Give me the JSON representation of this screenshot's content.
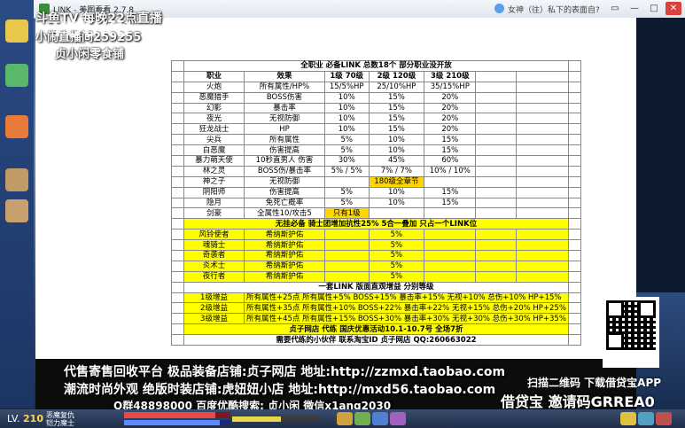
{
  "window": {
    "title": "LINK - 美图看看 2.7.8",
    "notice": "女神（往）私下的表面自?",
    "buttons": [
      "▭",
      "—",
      "□",
      "✕"
    ]
  },
  "stream_overlay": {
    "line1": "斗鱼TV 每晚22点直播",
    "line2": "小闹直播间259255",
    "line3": "贞小闲零食铺",
    "watermark": "YOUKU"
  },
  "sheet": {
    "title": "全职业  必备LINK 总数18个  部分职业没开放",
    "headers": [
      "职业",
      "效果",
      "1级 70级",
      "2级 120级",
      "3级 210级"
    ],
    "rows": [
      [
        "火炮",
        "所有属性/HP%",
        "15/5%HP",
        "25/10%HP",
        "35/15%HP"
      ],
      [
        "恶魔猎手",
        "BOSS伤害",
        "10%",
        "15%",
        "20%"
      ],
      [
        "幻影",
        "暴击率",
        "10%",
        "15%",
        "20%"
      ],
      [
        "夜光",
        "无视防御",
        "10%",
        "15%",
        "20%"
      ],
      [
        "狂龙战士",
        "HP",
        "10%",
        "15%",
        "20%"
      ],
      [
        "尖兵",
        "所有属性",
        "5%",
        "10%",
        "15%"
      ],
      [
        "白恶魔",
        "伤害提高",
        "5%",
        "10%",
        "15%"
      ],
      [
        "暴力萌天使",
        "10秒直男人 伤害",
        "30%",
        "45%",
        "60%"
      ],
      [
        "林之灵",
        "BOSS伤/暴击率",
        "5% / 5%",
        "7% / 7%",
        "10% / 10%"
      ],
      [
        "神之子",
        "无视防御",
        "",
        "180级全章节",
        ""
      ],
      [
        "阴阳师",
        "伤害提高",
        "5%",
        "10%",
        "15%"
      ],
      [
        "隐月",
        "免死亡概率",
        "5%",
        "10%",
        "15%"
      ],
      [
        "剑豪",
        "全属性10/攻击5",
        "只有1级",
        "",
        ""
      ]
    ],
    "knight_title": "无挂必备  骑士团增加抗性25% 5合一叠加  只占一个LINK位",
    "knights": [
      [
        "风铃使者",
        "希纳斯护佑",
        "5%"
      ],
      [
        "魂骑士",
        "希纳斯护佑",
        "5%"
      ],
      [
        "奇袭者",
        "希纳斯护佑",
        "5%"
      ],
      [
        "炎术士",
        "希纳斯护佑",
        "5%"
      ],
      [
        "夜行者",
        "希纳斯护佑",
        "5%"
      ]
    ],
    "link_title": "一套LINK 版面直观增益  分别等级",
    "levels": [
      [
        "1级增益",
        "所有属性+25点  所有属性+5% BOSS+15% 暴击率+15% 无视+10% 总伤+10% HP+15%"
      ],
      [
        "2级增益",
        "所有属性+35点  所有属性+10% BOSS+22% 暴击率+22% 无视+15% 总伤+20% HP+25%"
      ],
      [
        "3级增益",
        "所有属性+45点  所有属性+15% BOSS+30% 暴击率+30% 无视+30% 总伤+30% HP+35%"
      ]
    ],
    "shop_line1": "贞子网店  代练 国庆优惠活动10.1-10.7号  全场7折",
    "shop_line2": "需要代练的小伙伴  联系淘宝ID 贞子网店  QQ:260663022"
  },
  "promo": {
    "line1": "代售寄售回收平台 极品装备店铺:贞子网店 地址:http://zzmxd.taobao.com",
    "line2": "潮流时尚外观 绝版时装店铺:虎妞妞小店 地址:http://mxd56.taobao.com",
    "line3": "Q群48898000 百度优酷搜索: 贞小闲 微信x1ang2030",
    "right1": "扫描二维码 下载借贷宝APP",
    "right2": "借贷宝 邀请码GRREA0"
  },
  "status": {
    "level_prefix": "LV.",
    "level": "210",
    "name_line1": "恶魔复仇",
    "name_line2": "铠力魔士",
    "hp_fraction": 0.86,
    "mp_fraction": 0.9,
    "exp_fraction": 0.55
  }
}
